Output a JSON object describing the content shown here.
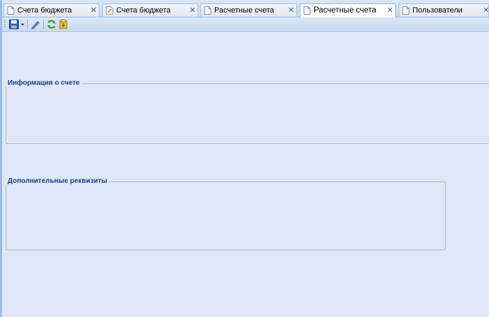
{
  "tabs": [
    {
      "label": "Счета бюджета",
      "active": false
    },
    {
      "label": "Счета бюджета",
      "active": false
    },
    {
      "label": "Расчетные счета",
      "active": false
    },
    {
      "label": "Расчетные счета",
      "active": true
    },
    {
      "label": "Пользователи",
      "active": false
    }
  ],
  "tab_close_glyph": "✕",
  "toolbar": {
    "icons": [
      "save-icon",
      "dropdown-arrow-icon",
      "edit-pen-icon",
      "refresh-icon",
      "export-icon"
    ]
  },
  "panels": {
    "account_info_title": "Информация о счете",
    "extra_details_title": "Дополнительные реквизиты"
  },
  "colors": {
    "background": "#dfe8f6",
    "legend_text": "#15428b",
    "panel_border": "#b5b8c8"
  }
}
